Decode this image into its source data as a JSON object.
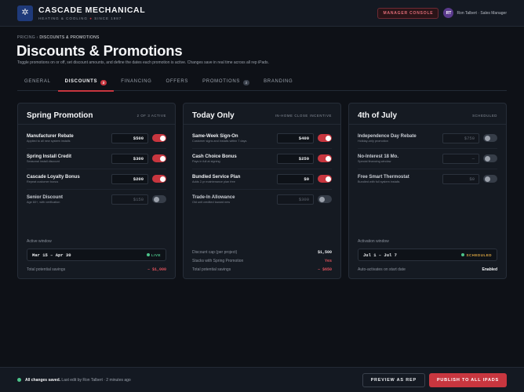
{
  "header": {
    "brand_name": "CASCADE MECHANICAL",
    "brand_sub_left": "HEATING & COOLING",
    "brand_sub_sep": "●",
    "brand_sub_right": "SINCE 1987",
    "console_badge": "MANAGER CONSOLE",
    "avatar_initials": "RT",
    "user_label": "Ron Talbert · Sales Manager"
  },
  "breadcrumb": {
    "parent": "PRICING",
    "sep": "›",
    "current": "DISCOUNTS & PROMOTIONS"
  },
  "page": {
    "title": "Discounts & Promotions",
    "description": "Toggle promotions on or off, set discount amounts, and define the dates each promotion is active. Changes save in real time across all rep iPads."
  },
  "tabs": [
    {
      "label": "GENERAL"
    },
    {
      "label": "DISCOUNTS",
      "count": "3"
    },
    {
      "label": "FINANCING"
    },
    {
      "label": "OFFERS"
    },
    {
      "label": "PROMOTIONS",
      "count": "3"
    },
    {
      "label": "BRANDING"
    }
  ],
  "cards": [
    {
      "title": "Spring Promotion",
      "tag": "2 OF 3 ACTIVE",
      "items": [
        {
          "name": "Manufacturer Rebate",
          "sub": "Applied to all new system installs",
          "amount": "$500",
          "on": true
        },
        {
          "name": "Spring Install Credit",
          "sub": "Seasonal install discount",
          "amount": "$300",
          "on": true
        },
        {
          "name": "Cascade Loyalty Bonus",
          "sub": "Repeat customer bonus",
          "amount": "$200",
          "on": true
        },
        {
          "name": "Senior Discount",
          "sub": "Age 60+, with verification",
          "amount": "$150",
          "on": false
        }
      ],
      "window_label": "Active window",
      "window_dates": "Mar 15 – Apr 30",
      "window_status": "LIVE",
      "stat_label": "Total potential savings",
      "stat_value": "− $1,000"
    },
    {
      "title": "Today Only",
      "tag": "IN-HOME CLOSE INCENTIVE",
      "items": [
        {
          "name": "Same-Week Sign-On",
          "sub": "Customer signs and installs within 7 days",
          "amount": "$400",
          "on": true
        },
        {
          "name": "Cash Choice Bonus",
          "sub": "Pays in full at signing",
          "amount": "$250",
          "on": true
        },
        {
          "name": "Bundled Service Plan",
          "sub": "Adds 2-yr maintenance plan free",
          "amount": "$0",
          "on": true
        },
        {
          "name": "Trade-In Allowance",
          "sub": "Old unit credited toward new",
          "amount": "$300",
          "on": false
        }
      ],
      "stats": [
        {
          "label": "Discount cap (per project)",
          "value": "$1,500",
          "kind": "normal"
        },
        {
          "label": "Stacks with Spring Promotion",
          "value": "Yes",
          "kind": "yes"
        },
        {
          "label": "Total potential savings",
          "value": "− $650",
          "kind": "neg"
        }
      ]
    },
    {
      "title": "4th of July",
      "tag": "SCHEDULED",
      "items": [
        {
          "name": "Independence Day Rebate",
          "sub": "Holiday-only promotion",
          "amount": "$750",
          "on": false
        },
        {
          "name": "No-Interest 18 Mo.",
          "sub": "Special financing window",
          "amount": "—",
          "on": false
        },
        {
          "name": "Free Smart Thermostat",
          "sub": "Bundled with full system installs",
          "amount": "$0",
          "on": false
        }
      ],
      "window_label": "Activation window",
      "window_dates": "Jul 1 – Jul 7",
      "window_status": "SCHEDULED",
      "stat_label": "Auto-activates on start date",
      "stat_value": "Enabled"
    }
  ],
  "footer": {
    "saved_bold": "All changes saved.",
    "saved_rest": "Last edit by Ron Talbert · 2 minutes ago",
    "preview_label": "PREVIEW AS REP",
    "publish_label": "PUBLISH TO ALL IPADS"
  },
  "colors": {
    "accent": "#c8363f",
    "live": "#4cc38a",
    "scheduled": "#d9a441",
    "background": "#0e1117"
  }
}
